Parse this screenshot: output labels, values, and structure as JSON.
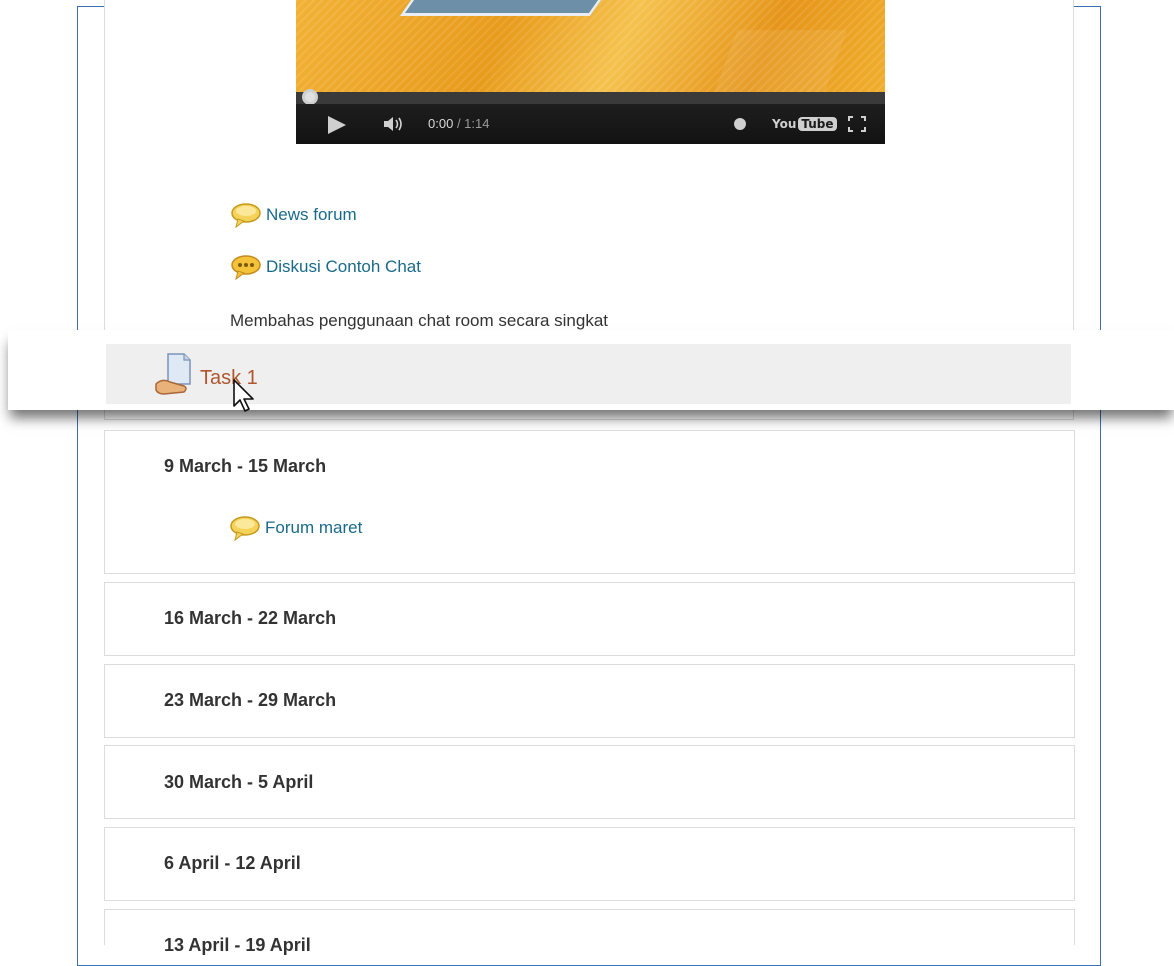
{
  "video": {
    "time_current": "0:00",
    "time_duration": "/ 1:14",
    "brand": "You",
    "brand_tube": "Tube",
    "progress": 0.0
  },
  "activities": [
    {
      "label": "News forum",
      "icon": "forum-icon"
    },
    {
      "label": "Diskusi Contoh Chat",
      "icon": "chat-icon"
    }
  ],
  "chat_description": "Membahas penggunaan chat room secara singkat",
  "dragged_item": {
    "label": "Task 1",
    "icon": "assignment-icon"
  },
  "weeks": [
    {
      "title": "9 March - 15 March",
      "activities": [
        {
          "label": "Forum maret",
          "icon": "forum-icon"
        }
      ]
    },
    {
      "title": "16 March - 22 March"
    },
    {
      "title": "23 March - 29 March"
    },
    {
      "title": "30 March - 5 April"
    },
    {
      "title": "6 April - 12 April"
    },
    {
      "title": "13 April - 19 April"
    }
  ],
  "colors": {
    "link": "#1a6a8a",
    "dragged_link": "#b0562f",
    "frame_border": "#3a6fb0"
  }
}
